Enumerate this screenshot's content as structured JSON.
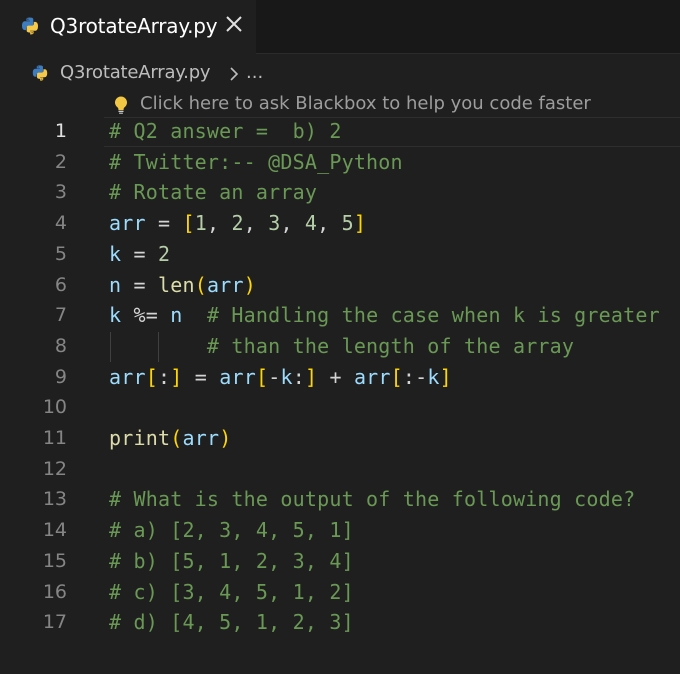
{
  "tab": {
    "label": "Q3rotateArray.py"
  },
  "breadcrumb": {
    "file": "Q3rotateArray.py",
    "more": "..."
  },
  "hint": {
    "text": "Click here to ask Blackbox to help you code faster"
  },
  "icons": {
    "file_icon": "python-icon",
    "close_icon": "close-icon",
    "chevron": "chevron-right-icon",
    "hint_icon": "lightbulb-icon"
  },
  "colors": {
    "comment": "#6a9955",
    "variable": "#9cdcfe",
    "number": "#b5cea8",
    "function": "#dcdcaa",
    "bracket": "#ffd700",
    "python_blue": "#3e7cc0",
    "python_yellow": "#f7c948",
    "bulb": "#f2c744"
  },
  "editor": {
    "active_line": 1,
    "lines": [
      {
        "num": "1",
        "tokens": [
          {
            "t": "# Q2 answer =  b) 2",
            "c": "com"
          }
        ]
      },
      {
        "num": "2",
        "tokens": [
          {
            "t": "# Twitter:-- @DSA_Python",
            "c": "com"
          }
        ]
      },
      {
        "num": "3",
        "tokens": [
          {
            "t": "# Rotate an array",
            "c": "com"
          }
        ]
      },
      {
        "num": "4",
        "tokens": [
          {
            "t": "arr",
            "c": "var"
          },
          {
            "t": " = ",
            "c": "op"
          },
          {
            "t": "[",
            "c": "br1"
          },
          {
            "t": "1",
            "c": "num"
          },
          {
            "t": ", ",
            "c": "op"
          },
          {
            "t": "2",
            "c": "num"
          },
          {
            "t": ", ",
            "c": "op"
          },
          {
            "t": "3",
            "c": "num"
          },
          {
            "t": ", ",
            "c": "op"
          },
          {
            "t": "4",
            "c": "num"
          },
          {
            "t": ", ",
            "c": "op"
          },
          {
            "t": "5",
            "c": "num"
          },
          {
            "t": "]",
            "c": "br1"
          }
        ]
      },
      {
        "num": "5",
        "tokens": [
          {
            "t": "k",
            "c": "var"
          },
          {
            "t": " = ",
            "c": "op"
          },
          {
            "t": "2",
            "c": "num"
          }
        ]
      },
      {
        "num": "6",
        "tokens": [
          {
            "t": "n",
            "c": "var"
          },
          {
            "t": " = ",
            "c": "op"
          },
          {
            "t": "len",
            "c": "fn"
          },
          {
            "t": "(",
            "c": "br1"
          },
          {
            "t": "arr",
            "c": "var"
          },
          {
            "t": ")",
            "c": "br1"
          }
        ]
      },
      {
        "num": "7",
        "tokens": [
          {
            "t": "k",
            "c": "var"
          },
          {
            "t": " %= ",
            "c": "op"
          },
          {
            "t": "n",
            "c": "var"
          },
          {
            "t": "  # Handling the case when k is greater",
            "c": "com"
          }
        ]
      },
      {
        "num": "8",
        "tokens": [
          {
            "t": "        # than the length of the array",
            "c": "com"
          }
        ],
        "guides": true
      },
      {
        "num": "9",
        "tokens": [
          {
            "t": "arr",
            "c": "var"
          },
          {
            "t": "[",
            "c": "br1"
          },
          {
            "t": ":",
            "c": "op"
          },
          {
            "t": "]",
            "c": "br1"
          },
          {
            "t": " = ",
            "c": "op"
          },
          {
            "t": "arr",
            "c": "var"
          },
          {
            "t": "[",
            "c": "br1"
          },
          {
            "t": "-",
            "c": "op"
          },
          {
            "t": "k",
            "c": "var"
          },
          {
            "t": ":",
            "c": "op"
          },
          {
            "t": "]",
            "c": "br1"
          },
          {
            "t": " + ",
            "c": "op"
          },
          {
            "t": "arr",
            "c": "var"
          },
          {
            "t": "[",
            "c": "br1"
          },
          {
            "t": ":-",
            "c": "op"
          },
          {
            "t": "k",
            "c": "var"
          },
          {
            "t": "]",
            "c": "br1"
          }
        ]
      },
      {
        "num": "10",
        "tokens": []
      },
      {
        "num": "11",
        "tokens": [
          {
            "t": "print",
            "c": "fn"
          },
          {
            "t": "(",
            "c": "br1"
          },
          {
            "t": "arr",
            "c": "var"
          },
          {
            "t": ")",
            "c": "br1"
          }
        ]
      },
      {
        "num": "12",
        "tokens": []
      },
      {
        "num": "13",
        "tokens": [
          {
            "t": "# What is the output of the following code?",
            "c": "com"
          }
        ]
      },
      {
        "num": "14",
        "tokens": [
          {
            "t": "# a) [2, 3, 4, 5, 1]",
            "c": "com"
          }
        ]
      },
      {
        "num": "15",
        "tokens": [
          {
            "t": "# b) [5, 1, 2, 3, 4]",
            "c": "com"
          }
        ]
      },
      {
        "num": "16",
        "tokens": [
          {
            "t": "# c) [3, 4, 5, 1, 2]",
            "c": "com"
          }
        ]
      },
      {
        "num": "17",
        "tokens": [
          {
            "t": "# d) [4, 5, 1, 2, 3]",
            "c": "com"
          }
        ]
      }
    ]
  }
}
